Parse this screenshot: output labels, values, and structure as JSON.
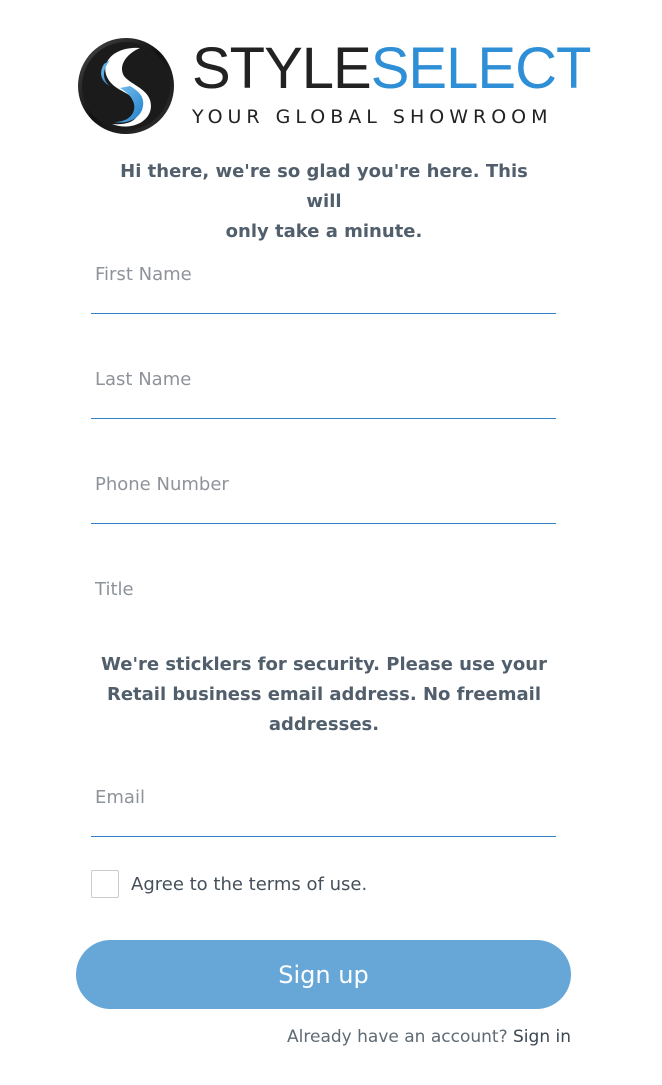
{
  "brand": {
    "name_part1": "STYLE",
    "name_part2": "SELECT",
    "tagline": "YOUR GLOBAL SHOWROOM",
    "colors": {
      "dark": "#222222",
      "blue": "#2e8fd6"
    }
  },
  "intro": {
    "line1": "Hi there, we're so glad you're here. This will",
    "line2": "only take a minute."
  },
  "form": {
    "first_name": {
      "placeholder": "First Name",
      "value": ""
    },
    "last_name": {
      "placeholder": "Last Name",
      "value": ""
    },
    "phone": {
      "placeholder": "Phone Number",
      "value": ""
    },
    "title": {
      "placeholder": "Title",
      "value": ""
    },
    "security_note": {
      "line1": "We're sticklers for security. Please use your",
      "line2": "Retail business email address. No freemail",
      "line3": "addresses."
    },
    "email": {
      "placeholder": "Email",
      "value": ""
    },
    "terms": {
      "text": "Agree to the terms of use.",
      "checked": false
    },
    "submit_label": "Sign up"
  },
  "footer": {
    "prompt": "Already have an account?",
    "signin_label": "Sign in"
  },
  "colors": {
    "accent": "#2f80c8",
    "button": "#67a7d8",
    "text": "#515e6b"
  }
}
